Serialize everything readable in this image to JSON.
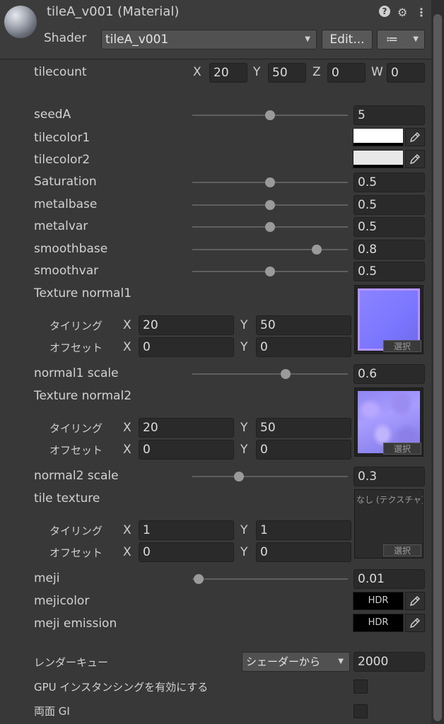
{
  "header": {
    "title": "tileA_v001 (Material)",
    "help_icon": "?",
    "settings_icon": "⚙",
    "menu_icon": "⋮",
    "shader_label": "Shader",
    "shader_value": "tileA_v001",
    "edit_label": "Edit...",
    "list_icon": "≔"
  },
  "tilecount": {
    "label": "tilecount",
    "x": "20",
    "y": "50",
    "z": "0",
    "w": "0"
  },
  "axes": {
    "x": "X",
    "y": "Y",
    "z": "Z",
    "w": "W"
  },
  "sliders": {
    "seedA": {
      "label": "seedA",
      "value": "5",
      "level": 0.5
    },
    "saturation": {
      "label": "Saturation",
      "value": "0.5",
      "level": 0.5
    },
    "metalbase": {
      "label": "metalbase",
      "value": "0.5",
      "level": 0.5
    },
    "metalvar": {
      "label": "metalvar",
      "value": "0.5",
      "level": 0.5
    },
    "smoothbase": {
      "label": "smoothbase",
      "value": "0.8",
      "level": 0.8
    },
    "smoothvar": {
      "label": "smoothvar",
      "value": "0.5",
      "level": 0.5
    },
    "normal1scale": {
      "label": "normal1 scale",
      "value": "0.6",
      "level": 0.6
    },
    "normal2scale": {
      "label": "normal2 scale",
      "value": "0.3",
      "level": 0.3
    },
    "meji": {
      "label": "meji",
      "value": "0.01",
      "level": 0.04
    }
  },
  "colors": {
    "tilecolor1": {
      "label": "tilecolor1",
      "color": "#ffffff"
    },
    "tilecolor2": {
      "label": "tilecolor2",
      "color": "#e8e8e8"
    },
    "mejicolor": {
      "label": "mejicolor",
      "text": "HDR"
    },
    "mejiemission": {
      "label": "meji emission",
      "text": "HDR"
    }
  },
  "textures": {
    "normal1": {
      "label": "Texture normal1",
      "tiling_label": "タイリング",
      "offset_label": "オフセット",
      "tiling_x": "20",
      "tiling_y": "50",
      "offset_x": "0",
      "offset_y": "0",
      "select_label": "選択"
    },
    "normal2": {
      "label": "Texture normal2",
      "tiling_label": "タイリング",
      "offset_label": "オフセット",
      "tiling_x": "20",
      "tiling_y": "50",
      "offset_x": "0",
      "offset_y": "0",
      "select_label": "選択"
    },
    "tile": {
      "label": "tile texture",
      "none_label": "なし (テクスチャ)",
      "tiling_label": "タイリング",
      "offset_label": "オフセット",
      "tiling_x": "1",
      "tiling_y": "1",
      "offset_x": "0",
      "offset_y": "0",
      "select_label": "選択"
    }
  },
  "footer": {
    "render_queue_label": "レンダーキュー",
    "render_queue_option": "シェーダーから",
    "render_queue_value": "2000",
    "gpu_instancing_label": "GPU インスタンシングを有効にする",
    "double_sided_gi_label": "両面 GI"
  }
}
